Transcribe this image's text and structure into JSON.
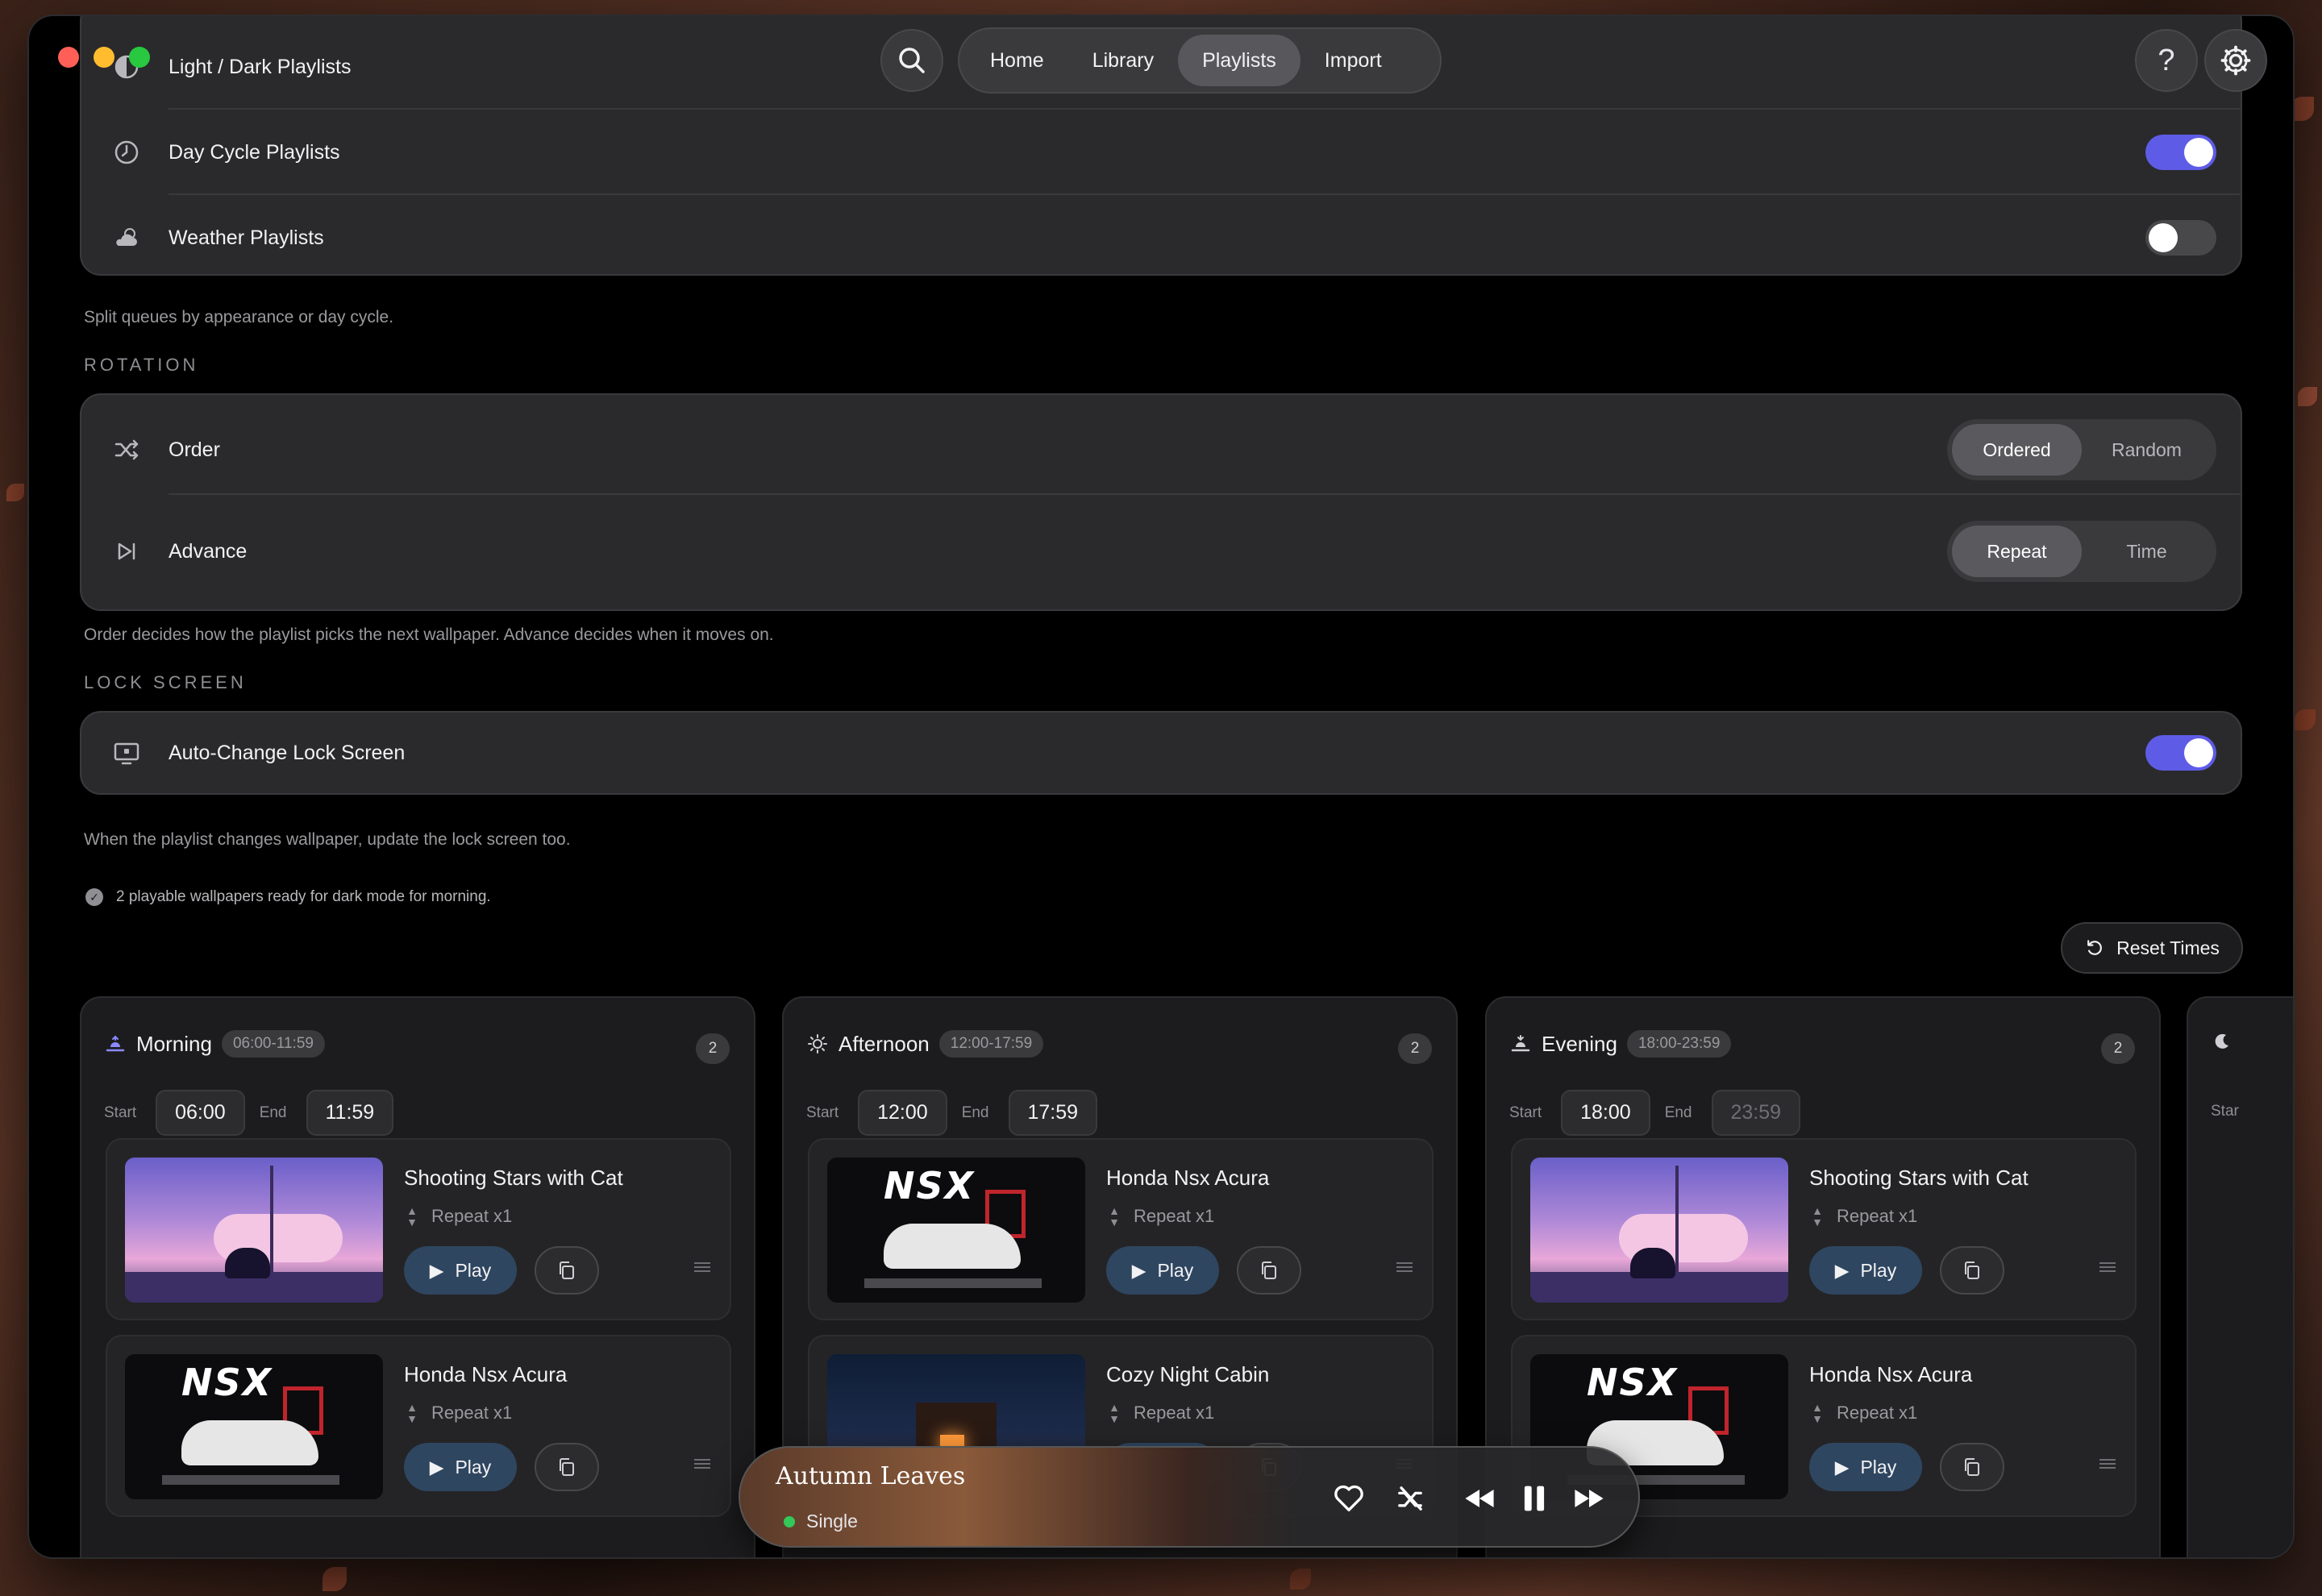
{
  "app": {
    "nav_tabs": [
      "Home",
      "Library",
      "Playlists",
      "Import"
    ],
    "active_tab": "Playlists"
  },
  "mode_section": {
    "rows": [
      {
        "label": "Light / Dark Playlists",
        "icon": "half-circle-icon"
      },
      {
        "label": "Day Cycle Playlists",
        "icon": "clock-icon",
        "enabled": true
      },
      {
        "label": "Weather Playlists",
        "icon": "cloud-sun-icon",
        "enabled": false
      }
    ],
    "caption": "Split queues by appearance or day cycle."
  },
  "rotation_section": {
    "heading": "ROTATION",
    "order": {
      "label": "Order",
      "options": [
        "Ordered",
        "Random"
      ],
      "selected": "Ordered"
    },
    "advance": {
      "label": "Advance",
      "options": [
        "Repeat",
        "Time"
      ],
      "selected": "Repeat"
    },
    "caption": "Order decides how the playlist picks the next wallpaper. Advance decides when it moves on."
  },
  "lock_screen_section": {
    "heading": "LOCK SCREEN",
    "label": "Auto-Change Lock Screen",
    "enabled": true,
    "caption": "When the playlist changes wallpaper, update the lock screen too."
  },
  "status": "2 playable wallpapers ready for dark mode for morning.",
  "reset_label": "Reset Times",
  "labels": {
    "start": "Start",
    "end": "End",
    "play": "Play"
  },
  "periods": [
    {
      "name": "Morning",
      "range": "06:00-11:59",
      "count": "2",
      "start": "06:00",
      "end": "11:59",
      "items": [
        {
          "title": "Shooting Stars with Cat",
          "repeat": "Repeat x1",
          "thumb": "cat"
        },
        {
          "title": "Honda Nsx Acura",
          "repeat": "Repeat x1",
          "thumb": "car"
        }
      ]
    },
    {
      "name": "Afternoon",
      "range": "12:00-17:59",
      "count": "2",
      "start": "12:00",
      "end": "17:59",
      "items": [
        {
          "title": "Honda Nsx Acura",
          "repeat": "Repeat x1",
          "thumb": "car"
        },
        {
          "title": "Cozy Night Cabin",
          "repeat": "Repeat x1",
          "thumb": "cabin"
        }
      ]
    },
    {
      "name": "Evening",
      "range": "18:00-23:59",
      "count": "2",
      "start": "18:00",
      "end": "23:59",
      "items": [
        {
          "title": "Shooting Stars with Cat",
          "repeat": "Repeat x1",
          "thumb": "cat"
        },
        {
          "title": "Honda Nsx Acura",
          "repeat": "Repeat x1",
          "thumb": "car"
        }
      ]
    }
  ],
  "night_partial_label": "Star",
  "thumb_logo_text": "NSX",
  "player": {
    "title": "Autumn Leaves",
    "mode": "Single",
    "controls": [
      "heart-icon",
      "shuffle-off-icon",
      "rewind-icon",
      "pause-icon",
      "fast-forward-icon"
    ]
  },
  "colors": {
    "accent": "#5e5ce6",
    "play_button": "#2f4660",
    "status_dot": "#34c759"
  }
}
